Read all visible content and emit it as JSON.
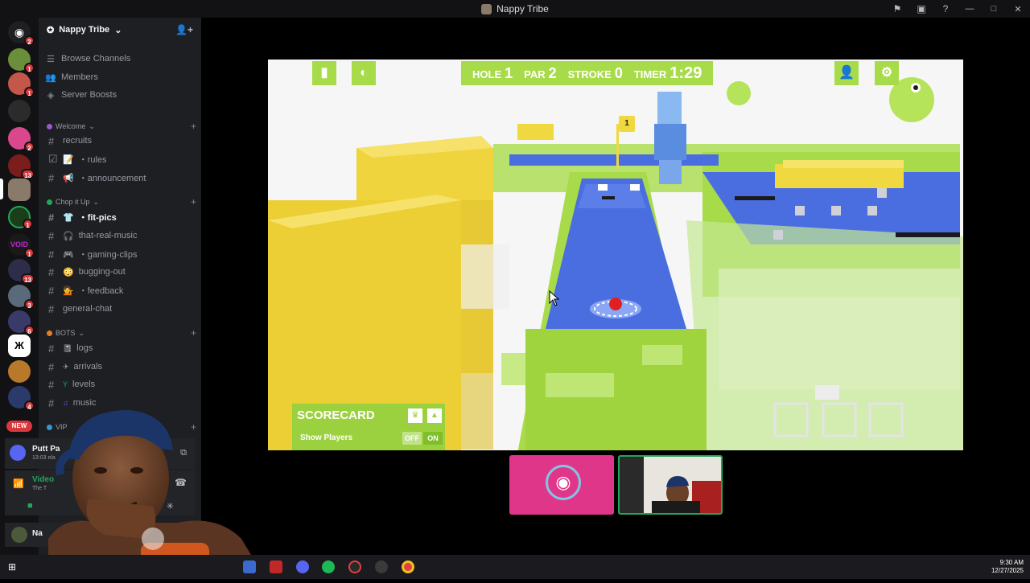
{
  "window": {
    "title": "Nappy Tribe"
  },
  "sidebar": {
    "server_name": "Nappy Tribe",
    "nav": [
      {
        "icon": "browse-channels-icon",
        "label": "Browse Channels"
      },
      {
        "icon": "members-icon",
        "label": "Members"
      },
      {
        "icon": "server-boosts-icon",
        "label": "Server Boosts"
      }
    ],
    "categories": {
      "welcome": {
        "label": "Welcome"
      },
      "chop": {
        "label": "Chop it Up"
      },
      "bots": {
        "label": "BOTS"
      },
      "vip": {
        "label": "VIP"
      }
    },
    "channels": {
      "recruits": "recruits",
      "rules": "・rules",
      "announcement": "・announcement",
      "fit_pics": "・fit-pics",
      "that_real_music": "that-real-music",
      "gaming_clips": "・gaming-clips",
      "bugging_out": "bugging-out",
      "feedback": "・feedback",
      "general_chat": "general-chat",
      "logs": "logs",
      "arrivals": "arrivals",
      "levels": "levels",
      "music": "music"
    }
  },
  "rail": {
    "badges": [
      "2",
      "1",
      "1",
      "2",
      "13",
      "1",
      "1",
      "13",
      "3",
      "6",
      "4"
    ],
    "new_label": "NEW"
  },
  "activity": {
    "name": "Putt Pa",
    "elapsed": "13:03 ela"
  },
  "voice": {
    "status": "Video",
    "channel": "The T"
  },
  "user": {
    "name": "Na"
  },
  "game": {
    "hud": {
      "hole_label": "HOLE",
      "hole_value": "1",
      "par_label": "PAR",
      "par_value": "2",
      "stroke_label": "STROKE",
      "stroke_value": "0",
      "timer_label": "TIMER",
      "timer_value": "1:29"
    },
    "flag_number": "1",
    "scorecard": {
      "title": "SCORECARD",
      "show_players": "Show Players",
      "off": "OFF",
      "on": "ON"
    },
    "colors": {
      "green": "#a8db4a",
      "blue": "#4a6ee0",
      "yellow": "#f0d840",
      "ball": "#e02020"
    }
  },
  "taskbar": {
    "time": "9:30 AM",
    "date": "12/27/2025"
  }
}
